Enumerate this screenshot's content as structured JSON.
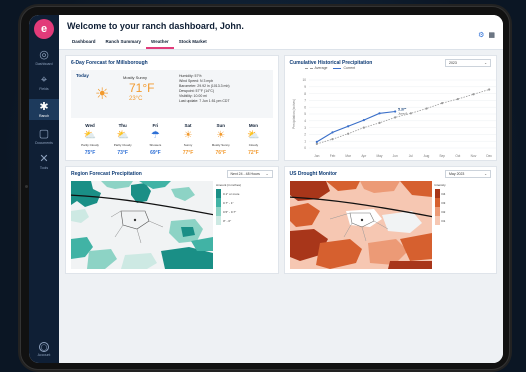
{
  "sidebar": {
    "logo": "e",
    "items": [
      {
        "label": "Dashboard",
        "icon": "eye-icon",
        "glyph": "◎"
      },
      {
        "label": "Fields",
        "icon": "pin-icon",
        "glyph": "⌖"
      },
      {
        "label": "Ranch",
        "icon": "sprout-icon",
        "glyph": "✱"
      },
      {
        "label": "Documents",
        "icon": "clipboard-icon",
        "glyph": "▢"
      },
      {
        "label": "Tools",
        "icon": "ruler-icon",
        "glyph": "✕"
      }
    ],
    "profile_label": "Account"
  },
  "header": {
    "welcome": "Welcome to your ranch dashboard, John.",
    "tabs": [
      "Dashboard",
      "Ranch Summary",
      "Weather",
      "Stock Market"
    ],
    "active_tab": "Weather"
  },
  "forecast": {
    "title": "6-Day Forecast for Millsborough",
    "today": {
      "label": "Today",
      "condition": "Mostly Sunny",
      "temp_f": "71°F",
      "temp_c": "23°C",
      "details": [
        "Humidity: 57%",
        "Wind Speed: N 3 mph",
        "Barometer: 29.92 in (1013.3 mb)",
        "Dewpoint: 57°F (14°C)",
        "Visibility: 10.00 mi",
        "Last update: 7 Jun 1:51 pm CDT"
      ]
    },
    "days": [
      {
        "name": "Wed",
        "condition": "Partly Cloudy",
        "temp": "75°F",
        "icon": "partly-cloudy-icon",
        "glyph": "⛅",
        "color": "#2d6fd6"
      },
      {
        "name": "Thu",
        "condition": "Partly Cloudy",
        "temp": "73°F",
        "icon": "partly-cloudy-icon",
        "glyph": "⛅",
        "color": "#2d6fd6"
      },
      {
        "name": "Fri",
        "condition": "Showers",
        "temp": "69°F",
        "icon": "rain-cloud-icon",
        "glyph": "☂",
        "color": "#2d6fd6"
      },
      {
        "name": "Sat",
        "condition": "Sunny",
        "temp": "77°F",
        "icon": "sun-icon",
        "glyph": "☀",
        "color": "#f29a2e"
      },
      {
        "name": "Sun",
        "condition": "Mostly Sunny",
        "temp": "76°F",
        "icon": "sun-icon",
        "glyph": "☀",
        "color": "#f29a2e"
      },
      {
        "name": "Mon",
        "condition": "Cloudy",
        "temp": "72°F",
        "icon": "cloud-sun-icon",
        "glyph": "⛅",
        "color": "#f29a2e"
      }
    ]
  },
  "precip": {
    "title": "Cumulative Historical Precipitation",
    "select": "2023",
    "legend_avg": "Average",
    "legend_cur": "Current",
    "annotation": [
      "5.37\"",
      "June 6"
    ]
  },
  "chart_data": {
    "type": "line",
    "x": [
      "Jan",
      "Feb",
      "Mar",
      "Apr",
      "May",
      "Jun",
      "Jul",
      "Aug",
      "Sep",
      "Oct",
      "Nov",
      "Dec"
    ],
    "ylabel": "Precipitation (inches)",
    "yticks": [
      "10",
      "9",
      "8",
      "7",
      "6",
      "5",
      "4",
      "3",
      "2",
      "1",
      "0"
    ],
    "ylim": [
      0,
      10
    ],
    "series": [
      {
        "name": "Average",
        "values": [
          0.6,
          1.3,
          2.1,
          3.0,
          3.7,
          4.5,
          5.1,
          5.8,
          6.6,
          7.2,
          7.9,
          8.6
        ],
        "color": "#999999"
      },
      {
        "name": "Current",
        "values": [
          0.9,
          2.3,
          3.2,
          4.1,
          5.1,
          5.37
        ],
        "color": "#3a6fc9"
      }
    ]
  },
  "regional": {
    "title": "Region Forecast Precipitation",
    "select": "Next 24 - 48 Hours",
    "legend_title": "Amount (in inches)",
    "legend": [
      {
        "label": "0.1\" or more",
        "color": "#1a8f86"
      },
      {
        "label": "0.7\" - 1\"",
        "color": "#41b3a5"
      },
      {
        "label": "0.5\" - 0.7\"",
        "color": "#8dd3c5"
      },
      {
        "label": "0\" - 0\"",
        "color": "#cde9e3"
      }
    ]
  },
  "drought": {
    "title": "US Drought Monitor",
    "select": "May 2023",
    "legend_title": "Intensity",
    "legend": [
      {
        "label": "D4",
        "color": "#a8361a"
      },
      {
        "label": "D3",
        "color": "#d6602f"
      },
      {
        "label": "D2",
        "color": "#ec9a76"
      },
      {
        "label": "D1",
        "color": "#f6c7b2"
      }
    ]
  }
}
